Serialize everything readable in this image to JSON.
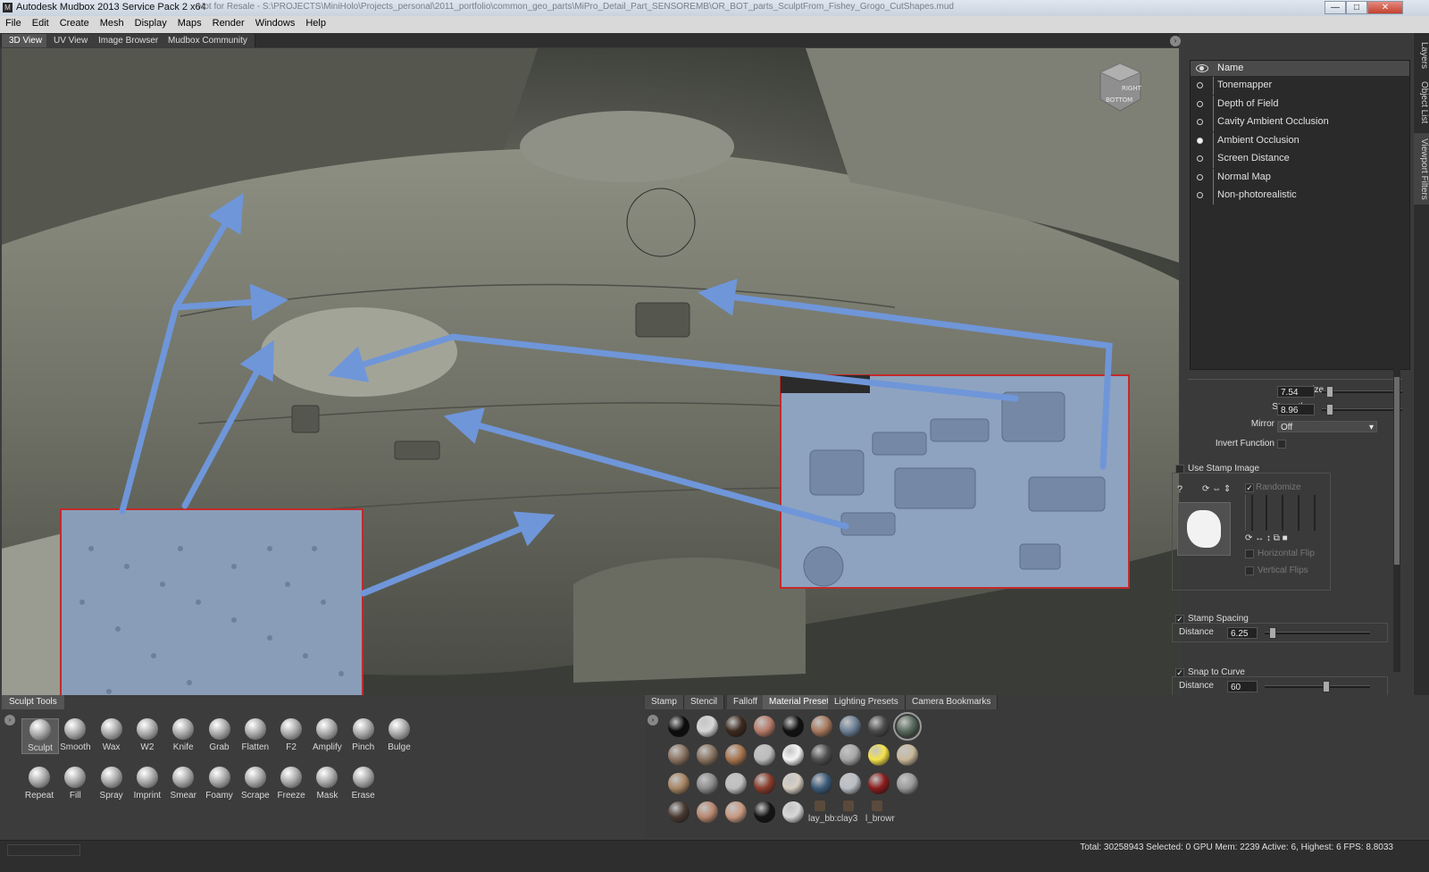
{
  "window": {
    "title": "Autodesk Mudbox 2013 Service Pack 2 x64",
    "path": "- Not for Resale - S:\\PROJECTS\\MiniHolo\\Projects_personal\\2011_portfolio\\common_geo_parts\\MiPro_Detail_Part_SENSOREMB\\OR_BOT_parts_SculptFrom_Fishey_Grogo_CutShapes.mud",
    "controls": {
      "minimize": "—",
      "maximize": "□",
      "close": "✕"
    }
  },
  "menu": [
    "File",
    "Edit",
    "Create",
    "Mesh",
    "Display",
    "Maps",
    "Render",
    "Windows",
    "Help"
  ],
  "view_tabs": [
    {
      "label": "3D View",
      "active": true
    },
    {
      "label": "UV View",
      "active": false
    },
    {
      "label": "Image Browser",
      "active": false
    },
    {
      "label": "Mudbox Community",
      "active": false
    }
  ],
  "viewcube": {
    "right": "RIGHT",
    "bottom": "BOTTOM"
  },
  "side_tabs": [
    "Layers",
    "Object List",
    "Viewport Filters"
  ],
  "filters": {
    "header": "Name",
    "items": [
      {
        "label": "Tonemapper",
        "on": false
      },
      {
        "label": "Depth of Field",
        "on": false
      },
      {
        "label": "Cavity Ambient Occlusion",
        "on": false
      },
      {
        "label": "Ambient Occlusion",
        "on": true
      },
      {
        "label": "Screen Distance",
        "on": false
      },
      {
        "label": "Normal Map",
        "on": false
      },
      {
        "label": "Non-photorealistic",
        "on": false
      }
    ]
  },
  "properties": {
    "size_label": "Size",
    "size_value": "7.54",
    "strength_label": "Strength",
    "strength_value": "8.96",
    "mirror_label": "Mirror",
    "mirror_value": "Off",
    "invert_label": "Invert Function",
    "use_stamp_label": "Use Stamp Image",
    "randomize_label": "Randomize",
    "hflip_label": "Horizontal Flip",
    "vflip_label": "Vertical Flips",
    "stamp_spacing_label": "Stamp Spacing",
    "stamp_distance_label": "Distance",
    "stamp_distance_value": "6.25",
    "snap_label": "Snap to Curve",
    "snap_distance_label": "Distance",
    "snap_distance_value": "60"
  },
  "sculpt": {
    "tab": "Sculpt Tools",
    "row1": [
      "Sculpt",
      "Smooth",
      "Wax",
      "W2",
      "Knife",
      "Grab",
      "Flatten",
      "F2",
      "Amplify",
      "Pinch",
      "Bulge"
    ],
    "row2": [
      "Repeat",
      "Fill",
      "Spray",
      "Imprint",
      "Smear",
      "Foamy",
      "Scrape",
      "Freeze",
      "Mask",
      "Erase"
    ]
  },
  "material_tabs": [
    {
      "label": "Stamp",
      "active": false
    },
    {
      "label": "Stencil",
      "active": false
    },
    {
      "label": "Falloff",
      "active": false
    },
    {
      "label": "Material Presets",
      "active": true
    },
    {
      "label": "Lighting Presets",
      "active": false
    },
    {
      "label": "Camera Bookmarks",
      "active": false
    }
  ],
  "material_swatches": [
    [
      "#0c0c0c",
      "#d6d6d6",
      "#3d2a1e",
      "#b77b6a",
      "#111111",
      "#a8795e",
      "#6c7f96",
      "#4a4a4a",
      "#5a6b5e"
    ],
    [
      "#8b7361",
      "#8a7360",
      "#a8744e",
      "#bcbcbc",
      "#f5f5f5",
      "#505050",
      "#a6a6a6",
      "#f4e24a",
      "#c8b89a"
    ],
    [
      "#a88664",
      "#8c8c8c",
      "#c0c0c0",
      "#8a3c2c",
      "#d7cfc3",
      "#3b5b7a",
      "#b9bec6",
      "#8a1c1c",
      "#9a9a9a"
    ],
    [
      "#4a3a32",
      "#b98870",
      "#c99a83",
      "#141414",
      "#d8d8d8"
    ]
  ],
  "material_named": [
    "lay_bb:",
    "clay3",
    "l_browr"
  ],
  "status": "Total: 30258943  Selected: 0 GPU Mem: 2239  Active: 6, Highest: 6  FPS: 8.8033"
}
